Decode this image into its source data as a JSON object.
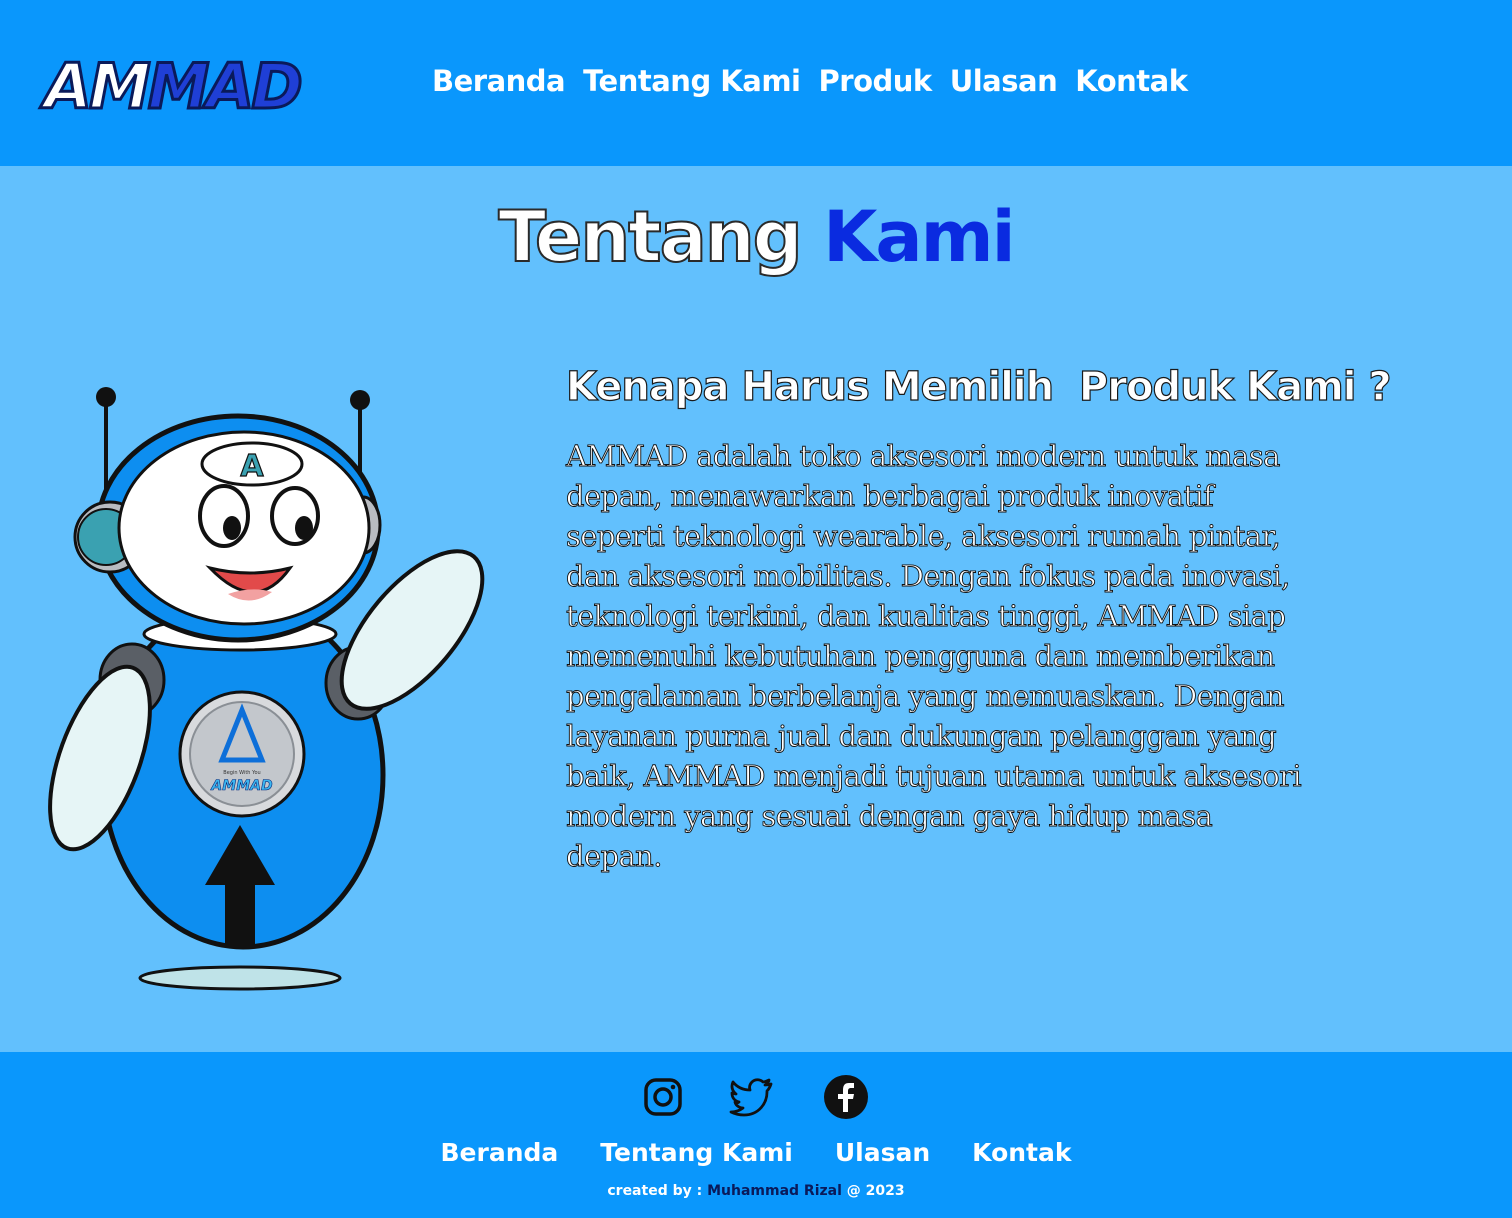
{
  "header": {
    "logo_part1": "AM",
    "logo_part2": "MAD",
    "nav": [
      "Beranda",
      "Tentang Kami",
      "Produk",
      "Ulasan",
      "Kontak"
    ]
  },
  "title": {
    "part1": "Tentang",
    "part2": "Kami"
  },
  "section": {
    "heading": "Kenapa Harus Memilih  Produk Kami ?",
    "body": "AMMAD adalah toko aksesori modern untuk masa depan, menawarkan berbagai produk inovatif seperti teknologi wearable, aksesori rumah pintar, dan aksesori mobilitas. Dengan fokus pada inovasi, teknologi terkini, dan kualitas tinggi, AMMAD siap memenuhi kebutuhan pengguna dan memberikan pengalaman berbelanja yang memuaskan. Dengan layanan purna jual dan dukungan pelanggan yang baik, AMMAD menjadi tujuan utama untuk aksesori modern yang sesuai dengan gaya hidup masa depan."
  },
  "robot": {
    "head_letter": "A",
    "badge_tagline": "Begin With You",
    "badge_name": "AMMAD"
  },
  "footer": {
    "social_icons": [
      "instagram-icon",
      "twitter-icon",
      "facebook-icon"
    ],
    "nav": [
      "Beranda",
      "Tentang Kami",
      "Ulasan",
      "Kontak"
    ],
    "credit_prefix": "created by : ",
    "credit_name": "Muhammad Rizal",
    "credit_suffix": " @ 2023"
  },
  "colors": {
    "header_bg": "#0a97fc",
    "page_bg": "#62c0fd",
    "accent_blue": "#0a2be0"
  }
}
